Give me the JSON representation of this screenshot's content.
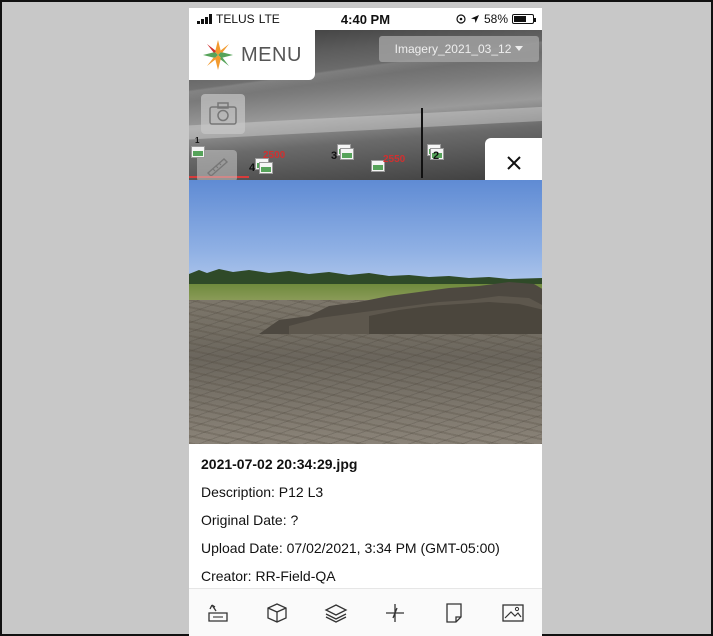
{
  "status_bar": {
    "carrier": "TELUS",
    "network": "LTE",
    "time": "4:40 PM",
    "battery": "58%"
  },
  "map": {
    "menu_label": "MENU",
    "imagery_select": "Imagery_2021_03_12",
    "pins": [
      {
        "count": "4"
      },
      {
        "count": "3"
      },
      {
        "count": "2"
      },
      {
        "count": "1"
      }
    ],
    "distance_labels": [
      "2500",
      "2550"
    ]
  },
  "photo": {
    "filename": "2021-07-02 20:34:29.jpg",
    "description": "Description: P12 L3",
    "original_date": "Original Date: ?",
    "upload_date": "Upload Date: 07/02/2021, 3:34 PM (GMT-05:00)",
    "creator": "Creator: RR-Field-QA"
  },
  "toolbar": {
    "icons": [
      "map-pointer-icon",
      "box-icon",
      "layers-icon",
      "crosshair-icon",
      "note-icon",
      "image-icon"
    ]
  },
  "colors": {
    "accent_orange": "#f29a2e",
    "accent_green": "#56a35a",
    "accent_red": "#d03030"
  }
}
